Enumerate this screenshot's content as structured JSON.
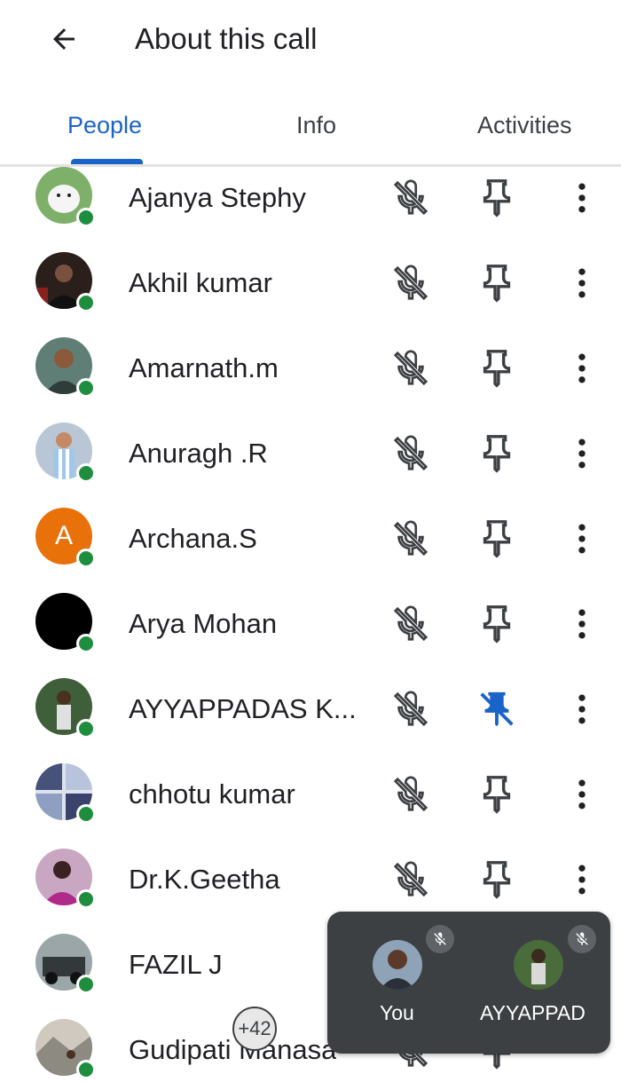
{
  "header": {
    "back_icon": "arrow-left-icon",
    "title": "About this call"
  },
  "tabs": [
    {
      "label": "People",
      "active": true
    },
    {
      "label": "Info",
      "active": false
    },
    {
      "label": "Activities",
      "active": false
    }
  ],
  "colors": {
    "accent": "#1a63c8",
    "online": "#1e8e3e",
    "text": "#202124",
    "icon": "#3c4043",
    "pip_bg": "#3c4043"
  },
  "participants": [
    {
      "name": "Ajanya Stephy",
      "avatar": "photo-white-dog",
      "muted": true,
      "pinned": false,
      "online": true
    },
    {
      "name": "Akhil kumar",
      "avatar": "photo-dark-movie-poster",
      "muted": true,
      "pinned": false,
      "online": true
    },
    {
      "name": "Amarnath.m",
      "avatar": "photo-man-portrait",
      "muted": true,
      "pinned": false,
      "online": true
    },
    {
      "name": "Anuragh .R",
      "avatar": "photo-footballer",
      "muted": true,
      "pinned": false,
      "online": true
    },
    {
      "name": "Archana.S",
      "avatar": "letter",
      "initial": "A",
      "avatar_color": "#e8710a",
      "muted": true,
      "pinned": false,
      "online": true
    },
    {
      "name": "Arya Mohan",
      "avatar": "solid-black",
      "muted": true,
      "pinned": false,
      "online": true
    },
    {
      "name": "AYYAPPADAS K...",
      "avatar": "photo-man-outdoor",
      "muted": true,
      "pinned": true,
      "online": true
    },
    {
      "name": "chhotu kumar",
      "avatar": "photo-collage",
      "muted": true,
      "pinned": false,
      "online": true
    },
    {
      "name": "Dr.K.Geetha",
      "avatar": "photo-woman-pink",
      "muted": true,
      "pinned": false,
      "online": true
    },
    {
      "name": "FAZIL J",
      "avatar": "photo-jeep",
      "muted": false,
      "pinned": false,
      "online": true
    },
    {
      "name": "Gudipati Manasa",
      "avatar": "photo-outdoor-person",
      "muted": true,
      "pinned": false,
      "online": true
    }
  ],
  "pip": {
    "tiles": [
      {
        "label": "You",
        "muted": true
      },
      {
        "label": "AYYAPPAD",
        "muted": true
      }
    ],
    "more_count": "+42"
  }
}
